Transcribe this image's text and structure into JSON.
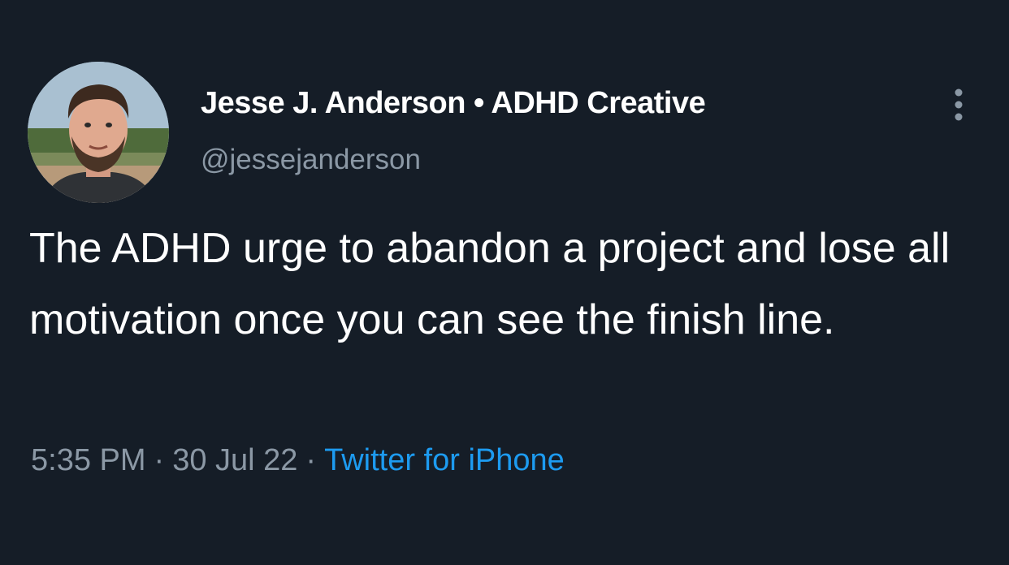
{
  "tweet": {
    "author": {
      "display_name": "Jesse J. Anderson • ADHD Creative",
      "handle": "@jessejanderson",
      "avatar_icon": "profile-photo"
    },
    "more_icon": "vertical-ellipsis-icon",
    "text": "The ADHD urge to abandon a project and lose all motivation once you can see the finish line.",
    "time": "5:35 PM",
    "date": "30 Jul 22",
    "separator": "·",
    "source": "Twitter for iPhone"
  },
  "colors": {
    "background": "#151d27",
    "text_primary": "#ffffff",
    "text_secondary": "#8b98a5",
    "link": "#1d9bf0"
  }
}
